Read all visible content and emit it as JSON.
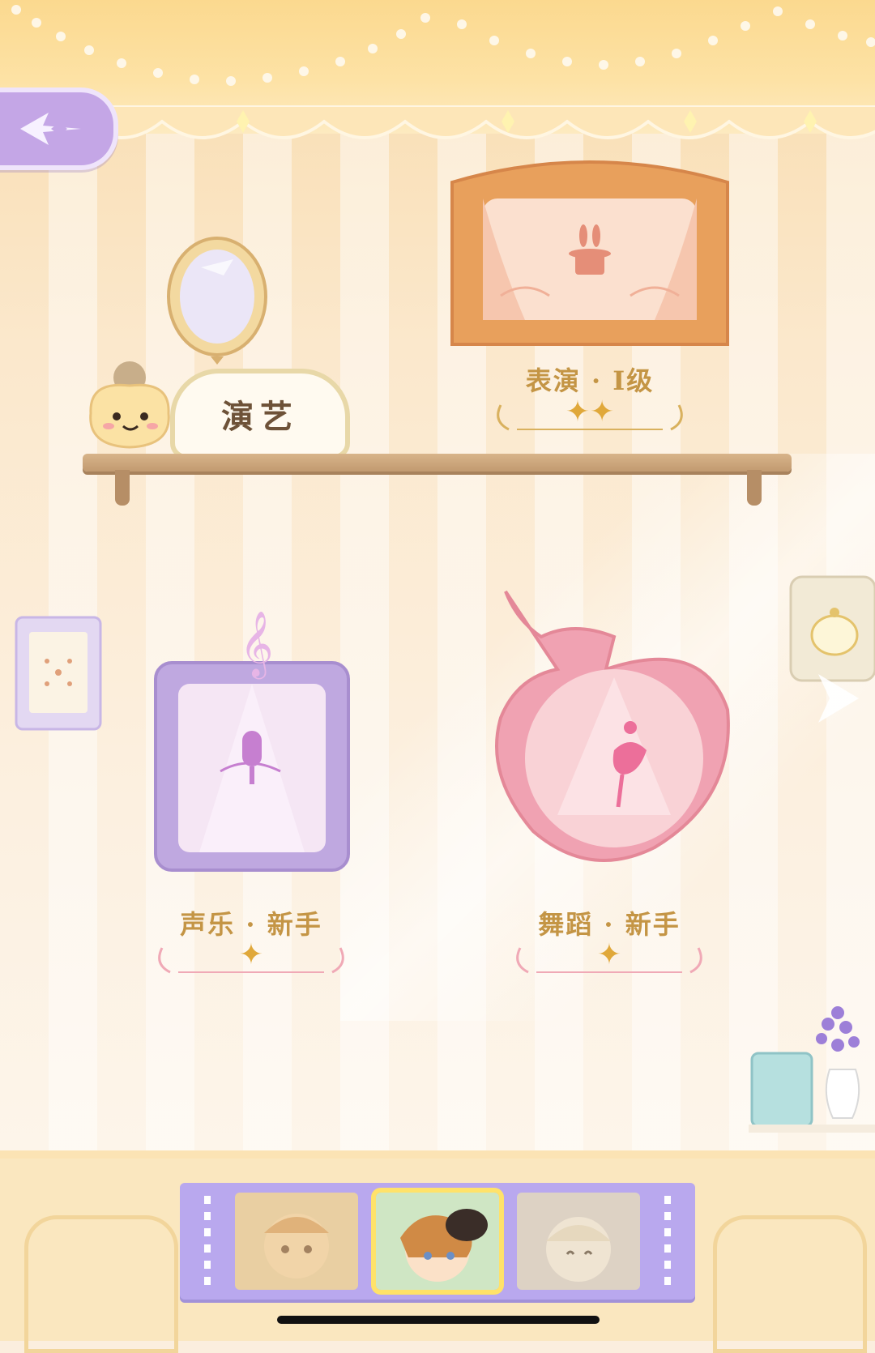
{
  "category": {
    "label": "演艺"
  },
  "skills": [
    {
      "id": "performance",
      "label": "表演 · Ⅰ级",
      "stars": 2
    },
    {
      "id": "vocal",
      "label": "声乐 · 新手",
      "stars": 1
    },
    {
      "id": "dance",
      "label": "舞蹈 · 新手",
      "stars": 1
    }
  ],
  "colors": {
    "performance_frame": "#e8a05c",
    "vocal_frame": "#bfa8e0",
    "dance_frame": "#f0a2b2",
    "label_gold": "#c49545",
    "star_gold": "#e0a83a",
    "char_bar": "#b9a8ee",
    "selected_outline": "#ffe26a"
  },
  "icons": {
    "back": "back-arrow-icon",
    "next": "next-arrow-icon",
    "performance": "magic-hat-rabbit-icon",
    "vocal": "microphone-icon",
    "dance": "ballerina-icon"
  },
  "characters": {
    "selected_index": 1,
    "count": 3
  }
}
